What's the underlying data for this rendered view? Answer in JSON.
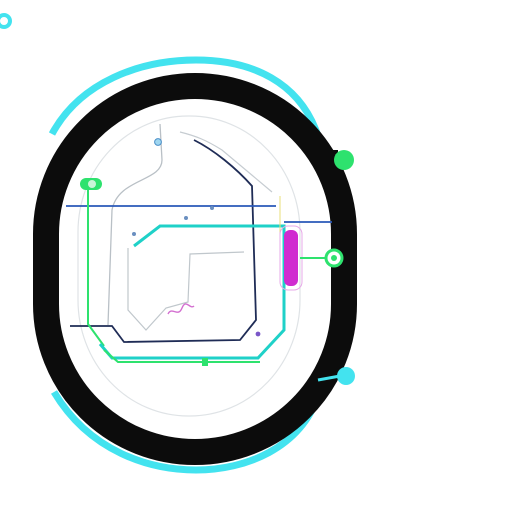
{
  "header": {
    "badge_icon": "ring-icon",
    "title": "",
    "subtitle": ""
  },
  "colors": {
    "cyan": "#43e3ef",
    "black": "#0c0c0c",
    "blue": "#2a58b8",
    "navy": "#1f2c56",
    "green": "#2ee26e",
    "teal": "#1fd1c8",
    "magenta": "#d02bd0",
    "gray": "#b9c0c6",
    "yellow": "#e8df7a"
  },
  "callouts": [
    {
      "id": "top",
      "marker": "green-dot",
      "title": "",
      "text": ""
    },
    {
      "id": "middle",
      "marker": "green-ring",
      "title": "",
      "text": ""
    },
    {
      "id": "bottom",
      "marker": "cyan-dot",
      "title": "",
      "text": ""
    }
  ],
  "footer": {
    "caption": ""
  }
}
